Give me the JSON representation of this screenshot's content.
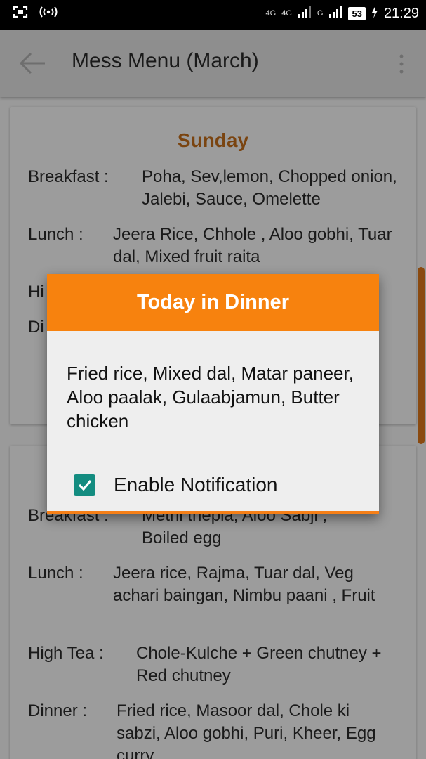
{
  "statusbar": {
    "left_icons": [
      "⌗",
      "(ı)"
    ],
    "net1": "4G",
    "net2": "4G",
    "sim2": "G",
    "battery": "53",
    "time": "21:29"
  },
  "appbar": {
    "title": "Mess Menu (March)"
  },
  "card1": {
    "day": "Sunday",
    "breakfast_label": "Breakfast :",
    "breakfast": "Poha, Sev,lemon, Chopped onion, Jalebi, Sauce, Omelette",
    "lunch_label": "Lunch :",
    "lunch": "Jeera Rice, Chhole , Aloo gobhi, Tuar dal,  Mixed fruit raita",
    "hightea_label_partial": "Hi",
    "dinner_label_partial": "Di"
  },
  "card2": {
    "breakfast_label_partial": "Breakfast :",
    "breakfast_line1_partial": "Methi thepla, Aloo Sabji ,",
    "breakfast_line2": "Boiled egg",
    "lunch_label": "Lunch :",
    "lunch": "Jeera rice, Rajma, Tuar dal, Veg achari baingan, Nimbu paani , Fruit",
    "hightea_label": "High Tea :",
    "hightea": "Chole-Kulche + Green chutney + Red chutney",
    "dinner_label": "Dinner :",
    "dinner": "Fried rice, Masoor dal, Chole ki sabzi,  Aloo gobhi, Puri, Kheer, Egg curry"
  },
  "dialog": {
    "title": "Today in Dinner",
    "body": "Fried rice, Mixed dal,  Matar paneer, Aloo paalak, Gulaabjamun, Butter chicken",
    "checkbox_label": "Enable Notification",
    "checkbox_checked": true
  },
  "colors": {
    "accent": "#f7820e",
    "checkbox": "#138c80",
    "day_title": "#7a4410"
  }
}
